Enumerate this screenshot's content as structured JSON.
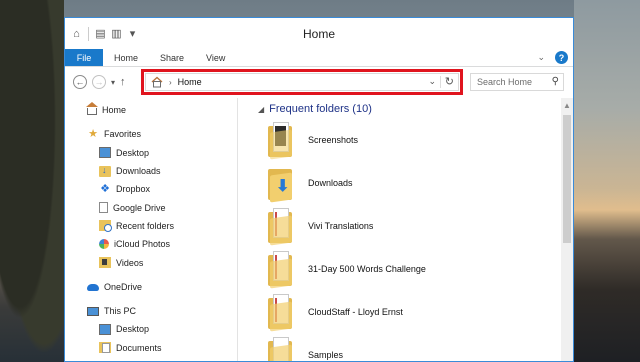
{
  "window": {
    "title": "Home",
    "border_color": "#3a8bd8",
    "highlight_color": "#e0141e"
  },
  "ribbon": {
    "tabs": [
      "File",
      "Home",
      "Share",
      "View"
    ]
  },
  "navbar": {
    "address_text": "Home",
    "search_placeholder": "Search Home"
  },
  "sidebar": {
    "items": [
      {
        "label": "Home",
        "icon": "home-icon"
      },
      {
        "label": "Favorites",
        "icon": "star-icon"
      },
      {
        "label": "Desktop",
        "icon": "desktop-icon"
      },
      {
        "label": "Downloads",
        "icon": "downloads-folder-icon"
      },
      {
        "label": "Dropbox",
        "icon": "dropbox-icon"
      },
      {
        "label": "Google Drive",
        "icon": "google-drive-icon"
      },
      {
        "label": "Recent folders",
        "icon": "recent-folders-icon"
      },
      {
        "label": "iCloud Photos",
        "icon": "icloud-photos-icon"
      },
      {
        "label": "Videos",
        "icon": "videos-folder-icon"
      },
      {
        "label": "OneDrive",
        "icon": "onedrive-icon"
      },
      {
        "label": "This PC",
        "icon": "computer-icon"
      },
      {
        "label": "Desktop",
        "icon": "desktop-icon"
      },
      {
        "label": "Documents",
        "icon": "documents-folder-icon"
      }
    ]
  },
  "content": {
    "group_title": "Frequent folders (10)",
    "folders": [
      {
        "label": "Screenshots",
        "icon": "screenshots-folder-icon"
      },
      {
        "label": "Downloads",
        "icon": "downloads-folder-icon"
      },
      {
        "label": "Vivi Translations",
        "icon": "folder-icon"
      },
      {
        "label": "31-Day 500 Words Challenge",
        "icon": "folder-icon"
      },
      {
        "label": "CloudStaff - Lloyd Ernst",
        "icon": "folder-icon"
      },
      {
        "label": "Samples",
        "icon": "folder-icon"
      }
    ]
  }
}
